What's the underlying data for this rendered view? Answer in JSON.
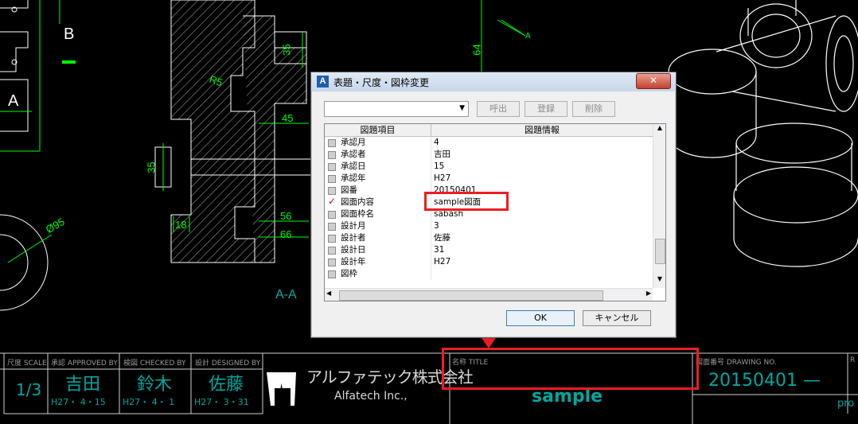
{
  "cad_labels": {
    "section_b": "B",
    "section_a": "A",
    "aa_label": "A-A",
    "r5": "R5",
    "dim_35_top": "35",
    "dim_64": "64",
    "dim_45": "45",
    "dim_35_left": "35",
    "dim_18": "18",
    "dim_56": "56",
    "dim_66": "66",
    "dim_diameter": "Ø95",
    "a_marker": "A"
  },
  "title_block": {
    "scale_header": "尺度 SCALE",
    "scale_value": "1/3",
    "approved_header": "承認 APPROVED BY",
    "approved_name": "吉田",
    "approved_date": "H27・ 4・15",
    "checked_header": "検図 CHECKED BY",
    "checked_name": "鈴木",
    "checked_date": "H27・ 4・ 1",
    "designed_header": "設計 DESIGNED BY",
    "designed_name": "佐藤",
    "designed_date": "H27・ 3・31",
    "company_jp": "アルファテック株式会社",
    "company_en": "Alfatech Inc.,",
    "title_header": "名称 TITLE",
    "title_value": "sample",
    "drawing_no_header": "図面番号 DRAWING NO.",
    "drawing_no_value": "20150401 —",
    "right_cut_header": "R",
    "right_cut_value": "pro"
  },
  "dialog": {
    "title": "表題・尺度・図枠変更",
    "close_label": "✕",
    "app_icon_label": "A",
    "combo_value": "",
    "buttons": {
      "call": "呼出",
      "register": "登録",
      "delete": "削除",
      "ok": "OK",
      "cancel": "キャンセル"
    },
    "columns": {
      "item": "図題項目",
      "info": "図題情報"
    },
    "rows": [
      {
        "key": "承認月",
        "value": "4",
        "checked": false
      },
      {
        "key": "承認者",
        "value": "吉田",
        "checked": false
      },
      {
        "key": "承認日",
        "value": "15",
        "checked": false
      },
      {
        "key": "承認年",
        "value": "H27",
        "checked": false
      },
      {
        "key": "図番",
        "value": "20150401",
        "checked": false
      },
      {
        "key": "図面内容",
        "value": "sample図面",
        "checked": true
      },
      {
        "key": "図面枠名",
        "value": "sabash",
        "checked": false
      },
      {
        "key": "設計月",
        "value": "3",
        "checked": false
      },
      {
        "key": "設計者",
        "value": "佐藤",
        "checked": false
      },
      {
        "key": "設計日",
        "value": "31",
        "checked": false
      },
      {
        "key": "設計年",
        "value": "H27",
        "checked": false
      },
      {
        "key": "図枠",
        "value": "",
        "checked": false
      }
    ]
  },
  "colors": {
    "highlight": "#ee1c24",
    "cad_green": "#00ff00",
    "title_cyan": "#00a7a0",
    "background": "#000000"
  }
}
